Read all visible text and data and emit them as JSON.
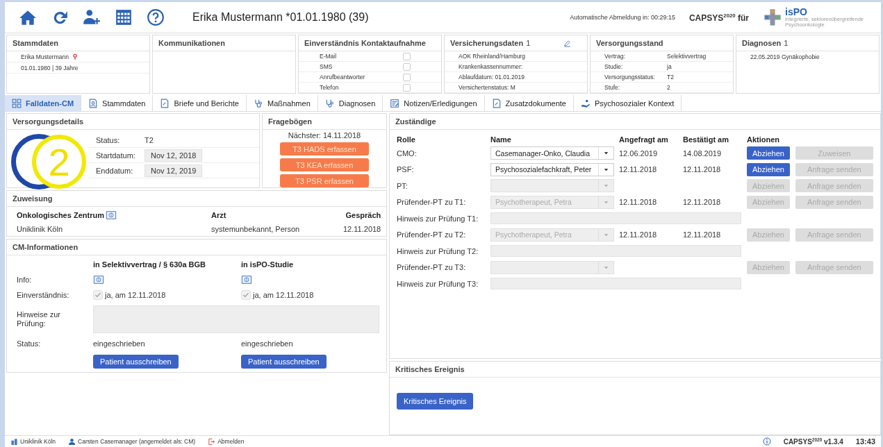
{
  "header": {
    "patient": "Erika Mustermann *01.01.1980 (39)",
    "logout_timer": "Automatische Abmeldung in: 00:29:15",
    "brand": "CAPSYS$^{2020}$ für",
    "logo_text": "isPO",
    "logo_subtitle": "Integrierte, sektorenübergreifende Psychoonkologie"
  },
  "stammdaten": {
    "title": "Stammdaten",
    "name": "Erika Mustermann",
    "birth": "01.01.1980 | 39 Jahre"
  },
  "kommunikationen": {
    "title": "Kommunikationen"
  },
  "einverstaendnis": {
    "title": "Einverständnis Kontaktaufnahme",
    "items": [
      {
        "label": "E-Mail",
        "checked": false
      },
      {
        "label": "SMS",
        "checked": false
      },
      {
        "label": "Anrufbeantworter",
        "checked": false
      },
      {
        "label": "Telefon",
        "checked": false
      }
    ]
  },
  "versicherung": {
    "title": "Versicherungsdaten",
    "count": "1",
    "lines": [
      "AOK Rheinland/Hamburg",
      "Krankenkassennummer:",
      "Ablaufdatum: 01.01.2019",
      "Versichertenstatus: M"
    ]
  },
  "versorgungsstand": {
    "title": "Versorgungsstand",
    "rows": [
      {
        "label": "Vertrag:",
        "value": "Selektivvertrag"
      },
      {
        "label": "Studie:",
        "value": "ja"
      },
      {
        "label": "Versorgungsstatus:",
        "value": "T2"
      },
      {
        "label": "Stufe:",
        "value": "2"
      }
    ]
  },
  "diagnosen": {
    "title": "Diagnosen",
    "count": "1",
    "lines": [
      "22.05.2019 Gynäkophobie"
    ]
  },
  "tabs": [
    {
      "label": "Falldaten-CM",
      "selected": true
    },
    {
      "label": "Stammdaten",
      "selected": false
    },
    {
      "label": "Briefe und Berichte",
      "selected": false
    },
    {
      "label": "Maßnahmen",
      "selected": false
    },
    {
      "label": "Diagnosen",
      "selected": false
    },
    {
      "label": "Notizen/Erledigungen",
      "selected": false
    },
    {
      "label": "Zusatzdokumente",
      "selected": false
    },
    {
      "label": "Psychosozialer Kontext",
      "selected": false
    }
  ],
  "versorgungsdetails": {
    "title": "Versorgungsdetails",
    "stage": "2",
    "rows": [
      {
        "label": "Status:",
        "value": "T2",
        "kind": "text"
      },
      {
        "label": "Startdatum:",
        "value": "Nov 12, 2018",
        "kind": "field"
      },
      {
        "label": "Enddatum:",
        "value": "Nov 12, 2019",
        "kind": "field"
      }
    ]
  },
  "frageboegen": {
    "title": "Fragebögen",
    "next": "Nächster: 14.11.2018",
    "buttons": [
      "T3 HADS erfassen",
      "T3 KEA erfassen",
      "T3 PSR erfassen"
    ]
  },
  "zuweisung": {
    "title": "Zuweisung",
    "columns": [
      "Onkologisches Zentrum",
      "Arzt",
      "Gespräch"
    ],
    "row": [
      "Uniklinik Köln",
      "systemunbekannt, Person",
      "12.11.2018"
    ]
  },
  "cm_informationen": {
    "title": "CM-Informationen",
    "row_labels": [
      "Info:",
      "Einverständnis:",
      "Hinweise zur Prüfung:",
      "Status:"
    ],
    "contracts": [
      {
        "heading": "in Selektivvertrag / § 630a BGB",
        "consent": "ja, am 12.11.2018",
        "consent_checked": true,
        "status": "eingeschrieben",
        "button": "Patient ausschreiben"
      },
      {
        "heading": "in isPO-Studie",
        "consent": "ja, am 12.11.2018",
        "consent_checked": true,
        "status": "eingeschrieben",
        "button": "Patient ausschreiben"
      }
    ]
  },
  "zustaendige": {
    "title": "Zuständige",
    "columns": [
      "Rolle",
      "Name",
      "Angefragt am",
      "Bestätigt am",
      "Aktionen"
    ],
    "rows": [
      {
        "kind": "person",
        "role": "CMO:",
        "name": "Casemanager-Onko, Claudia",
        "disabled": false,
        "requested": "12.06.2019",
        "confirmed": "14.08.2019",
        "actions": [
          {
            "label": "Abziehen",
            "disabled": false
          },
          {
            "label": "Zuweisen",
            "disabled": true
          }
        ]
      },
      {
        "kind": "person",
        "role": "PSF:",
        "name": "Psychosozialefachkraft, Peter",
        "disabled": false,
        "requested": "12.11.2018",
        "confirmed": "12.11.2018",
        "actions": [
          {
            "label": "Abziehen",
            "disabled": false
          },
          {
            "label": "Anfrage senden",
            "disabled": true
          }
        ]
      },
      {
        "kind": "person",
        "role": "PT:",
        "disabled": true,
        "actions": [
          {
            "label": "Abziehen",
            "disabled": true
          },
          {
            "label": "Anfrage senden",
            "disabled": true
          }
        ]
      },
      {
        "kind": "person",
        "role": "Prüfender-PT zu T1:",
        "name": "Psychotherapeut, Petra",
        "disabled": true,
        "requested": "12.11.2018",
        "confirmed": "12.11.2018",
        "actions": [
          {
            "label": "Abziehen",
            "disabled": true
          },
          {
            "label": "Anfrage senden",
            "disabled": true
          }
        ]
      },
      {
        "kind": "note",
        "role": "Hinweis zur Prüfung T1:"
      },
      {
        "kind": "person",
        "role": "Prüfender-PT zu T2:",
        "name": "Psychotherapeut, Petra",
        "disabled": true,
        "requested": "12.11.2018",
        "confirmed": "12.11.2018",
        "actions": [
          {
            "label": "Abziehen",
            "disabled": true
          },
          {
            "label": "Anfrage senden",
            "disabled": true
          }
        ]
      },
      {
        "kind": "note",
        "role": "Hinweis zur Prüfung T2:"
      },
      {
        "kind": "person",
        "role": "Prüfender-PT zu T3:",
        "disabled": true,
        "actions": [
          {
            "label": "Abziehen",
            "disabled": true
          },
          {
            "label": "Anfrage senden",
            "disabled": true
          }
        ]
      },
      {
        "kind": "note",
        "role": "Hinweis zur Prüfung T3:"
      }
    ]
  },
  "kritisches_ereignis": {
    "title": "Kritisches Ereignis",
    "button": "Kritisches Ereignis"
  },
  "status_bar": {
    "clinic": "Uniklinik Köln",
    "user": "Carsten Casemanager (angemeldet als: CM)",
    "logout": "Abmelden",
    "version": "CAPSYS$^{2020}$ v1.3.4",
    "time": "13:43"
  }
}
